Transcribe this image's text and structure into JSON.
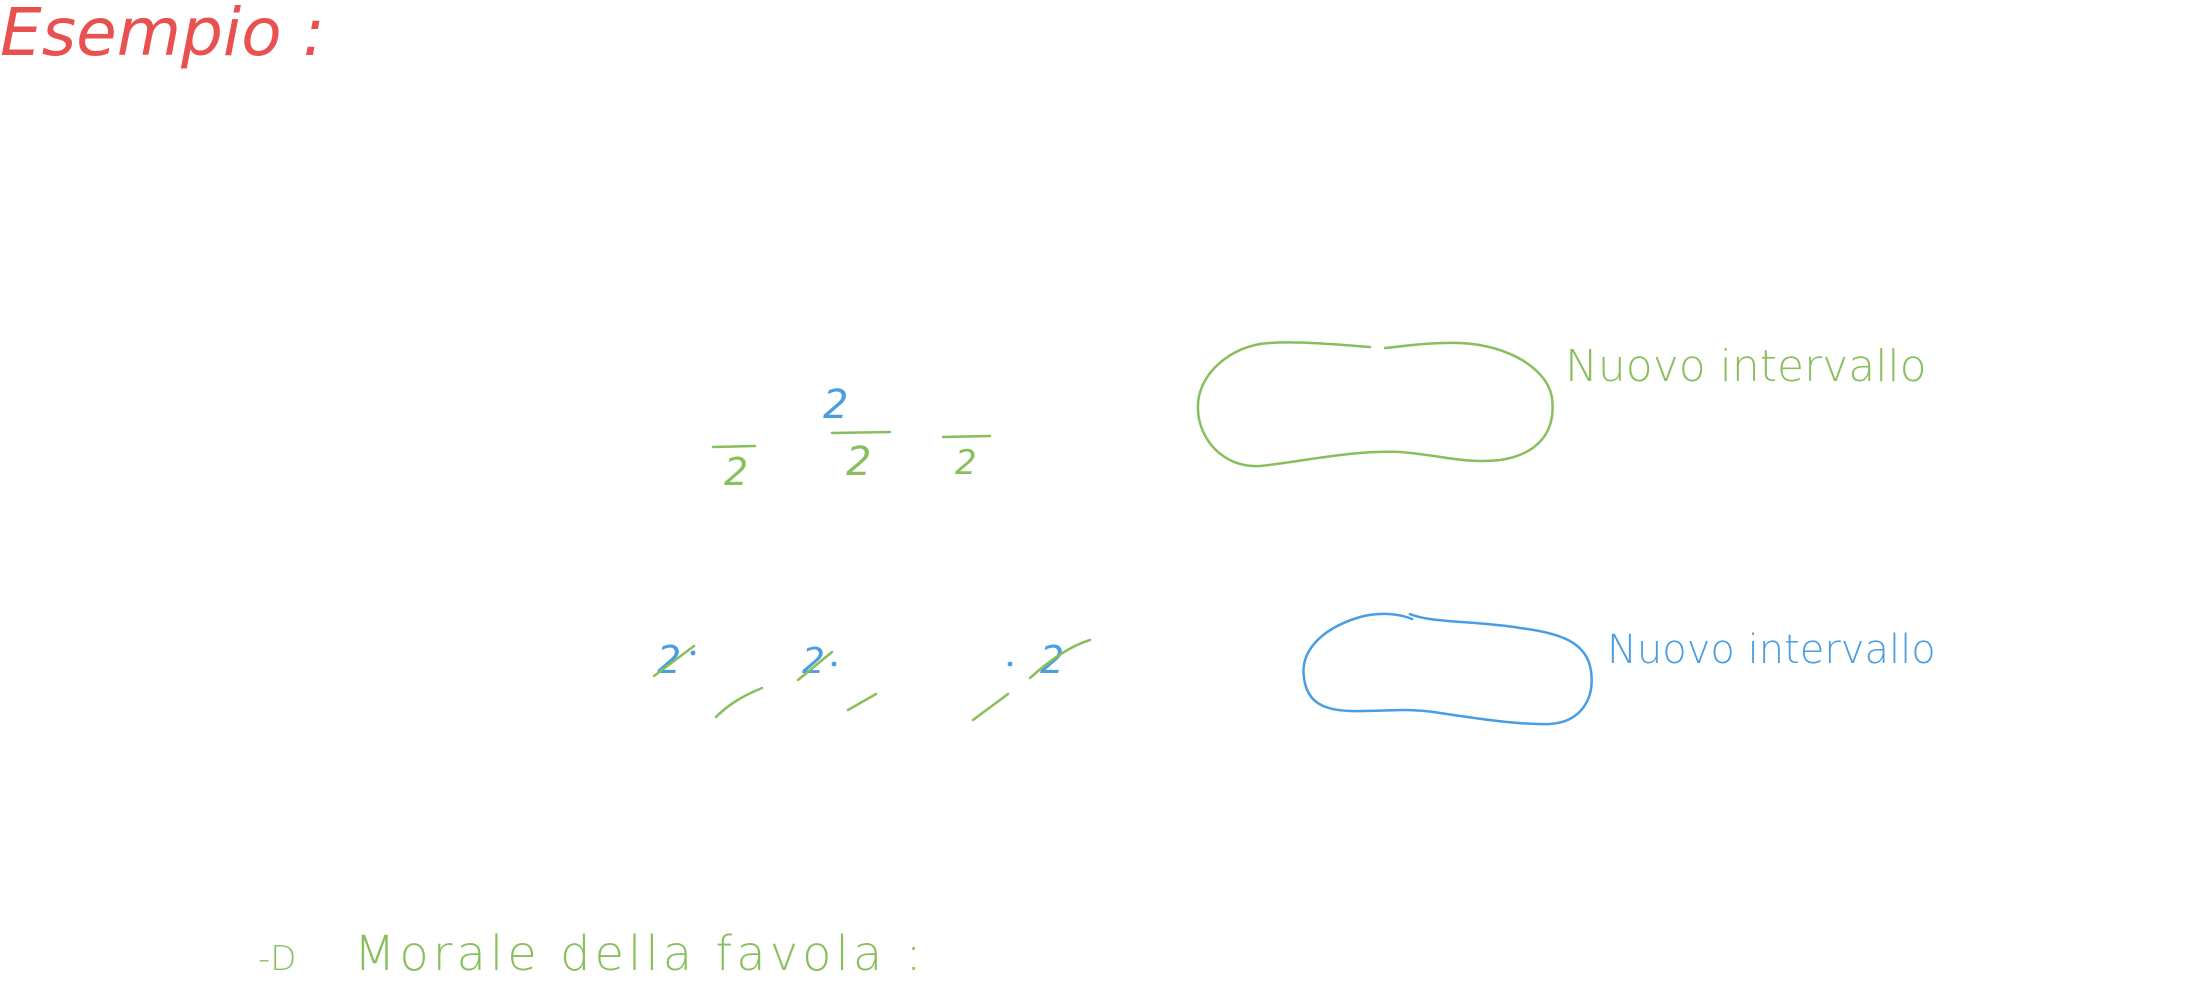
{
  "colors": {
    "red": "#e8514f",
    "green": "#88bf5c",
    "blue": "#4a9de0"
  },
  "title": "Esempio :",
  "row1": {
    "label": "Nuovo intervallo",
    "blue_digit": "2",
    "digits": [
      "2",
      "2",
      "2"
    ]
  },
  "row2": {
    "label": "Nuovo intervallo",
    "digits": [
      "2",
      "2",
      "2"
    ]
  },
  "morale": {
    "arrow": "-D",
    "text": "Morale della favola :"
  }
}
